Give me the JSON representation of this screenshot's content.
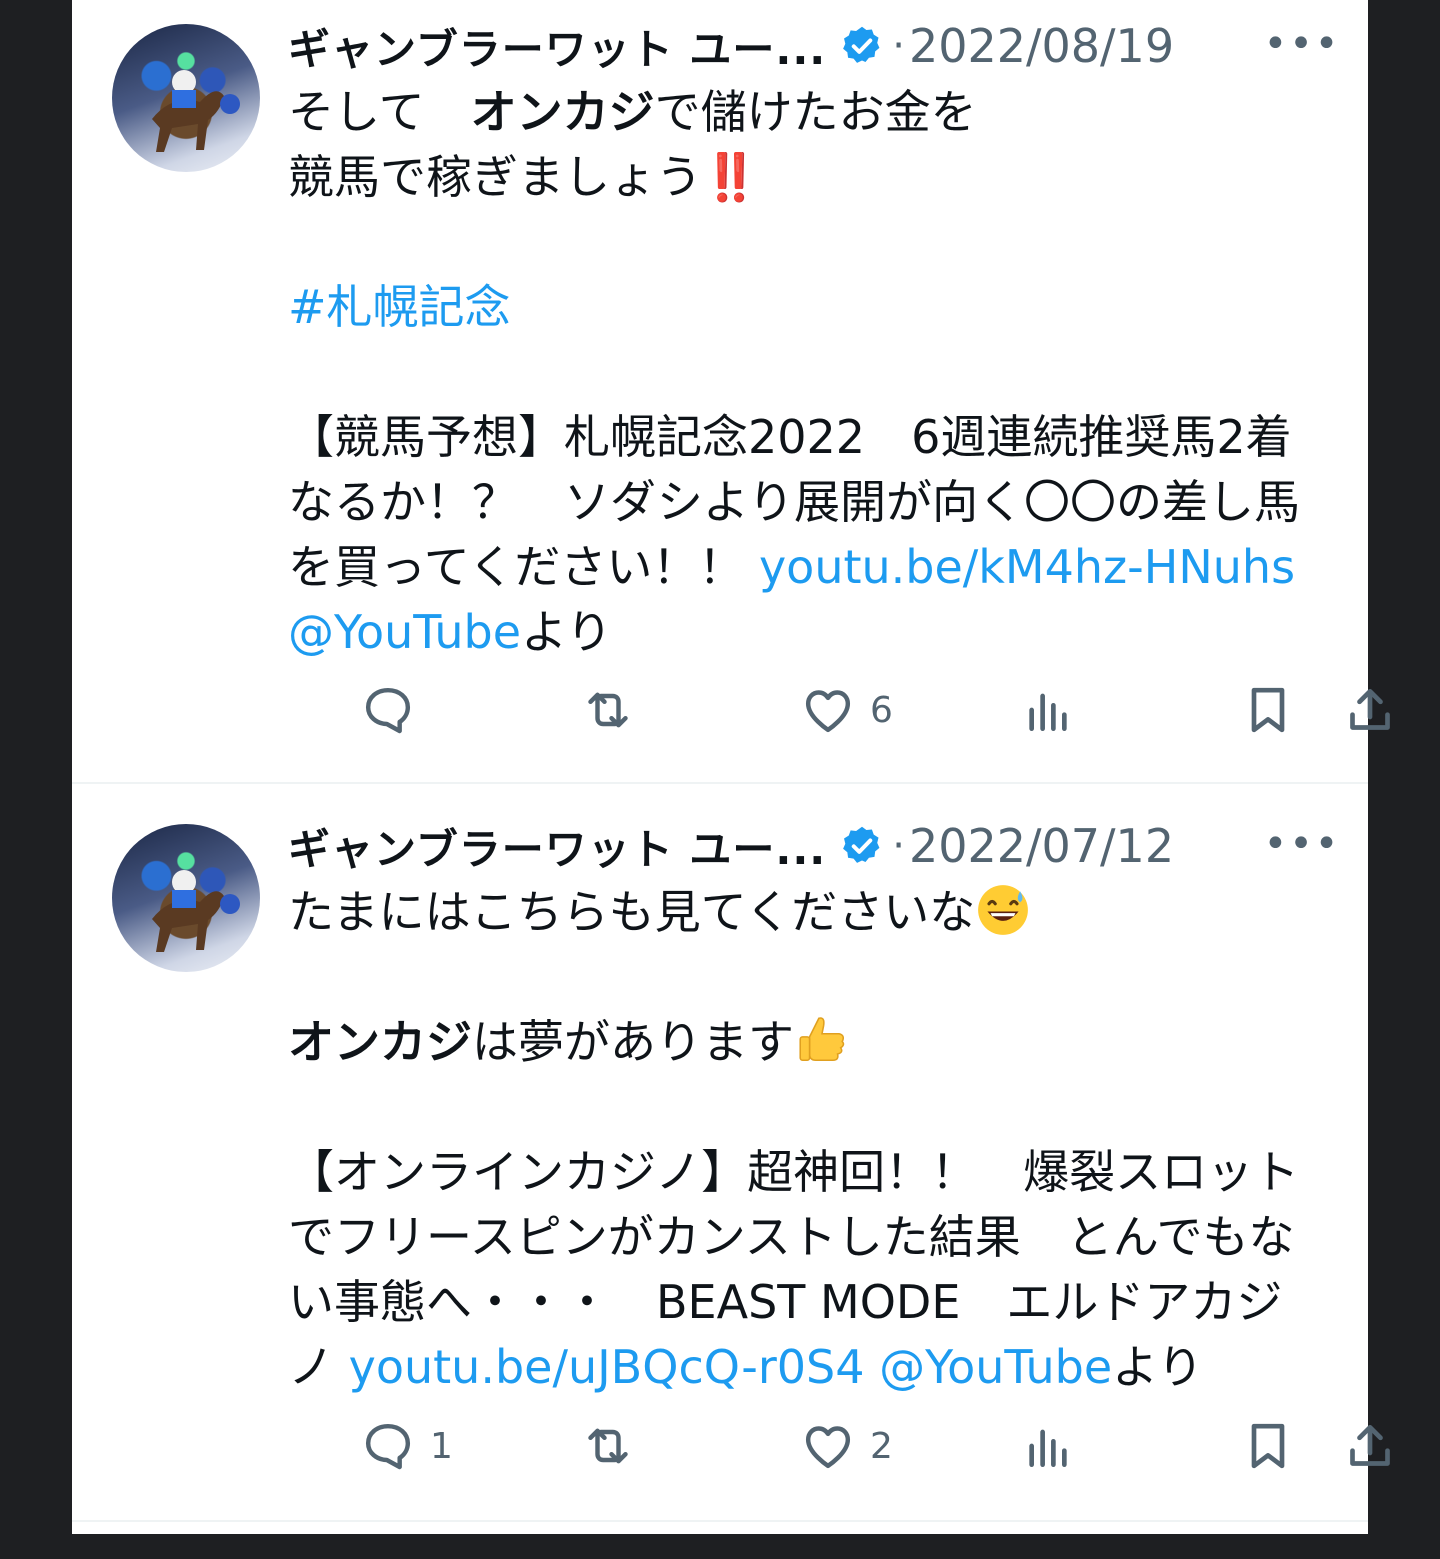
{
  "tweets": [
    {
      "author": "ギャンブラーワット ユー...",
      "separator": "·",
      "date": "2022/08/19",
      "more": "•••",
      "lines": {
        "l1_pre": "そして　",
        "l1_bold": "オンカジ",
        "l1_post": "で儲けたお金を",
        "l2": "競馬で稼ぎましょう",
        "l2_emoji": "‼️",
        "hashtag": "#札幌記念",
        "l4": "【競馬予想】札幌記念2022　6週連続推奨馬2着",
        "l5": "なるか！？　ソダシより展開が向く〇〇の差し馬",
        "l6_pre": "を買ってください！！ ",
        "l6_link": "youtu.be/kM4hz-HNuhs",
        "l7_link": "@YouTube",
        "l7_post": "より"
      },
      "replies": "",
      "likes": "6"
    },
    {
      "author": "ギャンブラーワット ユー...",
      "separator": "·",
      "date": "2022/07/12",
      "more": "•••",
      "lines": {
        "l1": "たまにはこちらも見てくださいな",
        "l1_emoji": "grinning-sweat-emoji",
        "l2_bold": "オンカジ",
        "l2_post": "は夢があります",
        "l2_emoji": "thumbs-up-emoji",
        "l3": "【オンラインカジノ】超神回！！　爆裂スロット",
        "l4": "でフリースピンがカンストした結果　とんでもな",
        "l5": "い事態へ・・・　BEAST MODE　エルドアカジ",
        "l6_pre": "ノ ",
        "l6_link1": "youtu.be/uJBQcQ-r0S4",
        "l6_space": " ",
        "l6_link2": "@YouTube",
        "l6_post": "より"
      },
      "replies": "1",
      "likes": "2"
    }
  ],
  "colors": {
    "link": "#1d9bf0",
    "muted": "#536471",
    "text": "#0f1419",
    "verified": "#1d9bf0",
    "background": "#1e1f22"
  }
}
